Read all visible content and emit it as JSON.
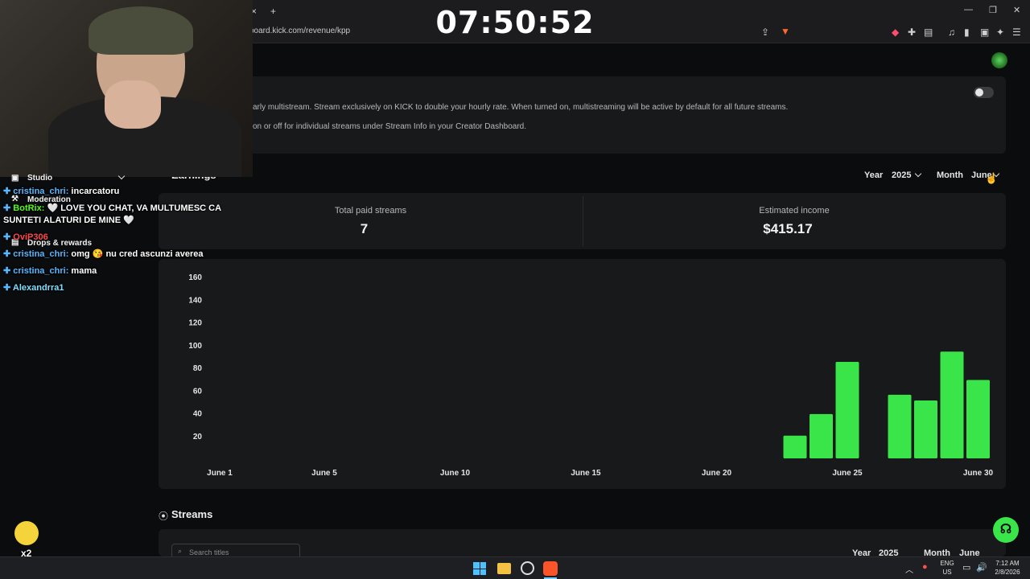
{
  "overlay": {
    "timer": "07:50:52",
    "sidebar": [
      {
        "label": "Studio"
      },
      {
        "label": "Moderation"
      },
      {
        "label": "Drops & rewards"
      }
    ],
    "chat": [
      {
        "user": "cristina_chri",
        "msg": "incarcatoru",
        "color": "#58b7ff"
      },
      {
        "user": "BotRix",
        "msg": "🤍 LOVE YOU CHAT, VA MULTUMESC CA",
        "color": "#53fc18"
      },
      {
        "user": "",
        "msg": "SUNTETI ALATURI DE MINE 🤍",
        "color": "#ffffff"
      },
      {
        "user": "OviP306",
        "msg": "",
        "color": "#ff4a4a"
      },
      {
        "user": "cristina_chri",
        "msg": "omg 😘 nu cred ascunzi averea",
        "color": "#58b7ff"
      },
      {
        "user": "cristina_chri",
        "msg": "mama",
        "color": "#58b7ff"
      },
      {
        "user": "Alexandrra1",
        "msg": "",
        "color": "#7fe0ff"
      }
    ],
    "duck_label": "x2"
  },
  "browser": {
    "url": "board.kick.com/revenue/kpp",
    "new_tab": "+",
    "close_tab": "×"
  },
  "multistream": {
    "line1": "arly multistream. Stream exclusively on KICK to double your hourly rate. When turned on, multistreaming will be active by default for all future streams.",
    "line2": "on or off for individual streams under Stream Info in your Creator Dashboard.",
    "toggle_on": false
  },
  "earnings": {
    "title": "Earnings",
    "year_label": "Year",
    "year_value": "2025",
    "month_label": "Month",
    "month_value": "June",
    "total_paid_label": "Total paid streams",
    "total_paid_value": "7",
    "income_label": "Estimated income",
    "income_value": "$415.17"
  },
  "chart_data": {
    "type": "bar",
    "x_ticks": [
      "June 1",
      "June 5",
      "June 10",
      "June 15",
      "June 20",
      "June 25",
      "June 30"
    ],
    "y_ticks": [
      20,
      40,
      60,
      80,
      100,
      120,
      140,
      160
    ],
    "ylim": [
      0,
      160
    ],
    "bar_color": "#3ae54a",
    "categories": [
      "June 23",
      "June 24",
      "June 25",
      "June 27",
      "June 28",
      "June 29",
      "June 30"
    ],
    "values": [
      20,
      39,
      85,
      56,
      51,
      94,
      69
    ]
  },
  "streams": {
    "title": "Streams",
    "search_placeholder": "Search titles",
    "year_label": "Year",
    "year_value": "2025",
    "month_label": "Month",
    "month_value": "June"
  },
  "taskbar": {
    "lang": "ENG",
    "region": "US",
    "time": "7:12 AM",
    "date": "2/8/2026"
  }
}
